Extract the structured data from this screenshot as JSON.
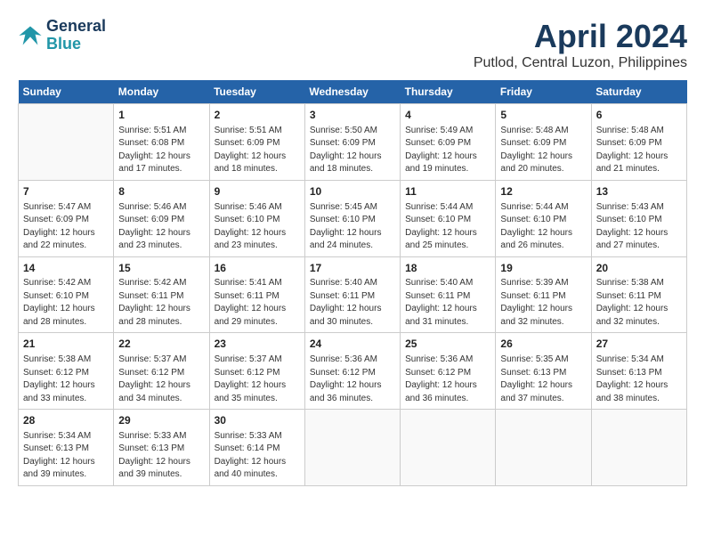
{
  "header": {
    "logo_line1": "General",
    "logo_line2": "Blue",
    "month": "April 2024",
    "location": "Putlod, Central Luzon, Philippines"
  },
  "calendar": {
    "days_of_week": [
      "Sunday",
      "Monday",
      "Tuesday",
      "Wednesday",
      "Thursday",
      "Friday",
      "Saturday"
    ],
    "weeks": [
      [
        {
          "day": "",
          "info": ""
        },
        {
          "day": "1",
          "info": "Sunrise: 5:51 AM\nSunset: 6:08 PM\nDaylight: 12 hours\nand 17 minutes."
        },
        {
          "day": "2",
          "info": "Sunrise: 5:51 AM\nSunset: 6:09 PM\nDaylight: 12 hours\nand 18 minutes."
        },
        {
          "day": "3",
          "info": "Sunrise: 5:50 AM\nSunset: 6:09 PM\nDaylight: 12 hours\nand 18 minutes."
        },
        {
          "day": "4",
          "info": "Sunrise: 5:49 AM\nSunset: 6:09 PM\nDaylight: 12 hours\nand 19 minutes."
        },
        {
          "day": "5",
          "info": "Sunrise: 5:48 AM\nSunset: 6:09 PM\nDaylight: 12 hours\nand 20 minutes."
        },
        {
          "day": "6",
          "info": "Sunrise: 5:48 AM\nSunset: 6:09 PM\nDaylight: 12 hours\nand 21 minutes."
        }
      ],
      [
        {
          "day": "7",
          "info": "Sunrise: 5:47 AM\nSunset: 6:09 PM\nDaylight: 12 hours\nand 22 minutes."
        },
        {
          "day": "8",
          "info": "Sunrise: 5:46 AM\nSunset: 6:09 PM\nDaylight: 12 hours\nand 23 minutes."
        },
        {
          "day": "9",
          "info": "Sunrise: 5:46 AM\nSunset: 6:10 PM\nDaylight: 12 hours\nand 23 minutes."
        },
        {
          "day": "10",
          "info": "Sunrise: 5:45 AM\nSunset: 6:10 PM\nDaylight: 12 hours\nand 24 minutes."
        },
        {
          "day": "11",
          "info": "Sunrise: 5:44 AM\nSunset: 6:10 PM\nDaylight: 12 hours\nand 25 minutes."
        },
        {
          "day": "12",
          "info": "Sunrise: 5:44 AM\nSunset: 6:10 PM\nDaylight: 12 hours\nand 26 minutes."
        },
        {
          "day": "13",
          "info": "Sunrise: 5:43 AM\nSunset: 6:10 PM\nDaylight: 12 hours\nand 27 minutes."
        }
      ],
      [
        {
          "day": "14",
          "info": "Sunrise: 5:42 AM\nSunset: 6:10 PM\nDaylight: 12 hours\nand 28 minutes."
        },
        {
          "day": "15",
          "info": "Sunrise: 5:42 AM\nSunset: 6:11 PM\nDaylight: 12 hours\nand 28 minutes."
        },
        {
          "day": "16",
          "info": "Sunrise: 5:41 AM\nSunset: 6:11 PM\nDaylight: 12 hours\nand 29 minutes."
        },
        {
          "day": "17",
          "info": "Sunrise: 5:40 AM\nSunset: 6:11 PM\nDaylight: 12 hours\nand 30 minutes."
        },
        {
          "day": "18",
          "info": "Sunrise: 5:40 AM\nSunset: 6:11 PM\nDaylight: 12 hours\nand 31 minutes."
        },
        {
          "day": "19",
          "info": "Sunrise: 5:39 AM\nSunset: 6:11 PM\nDaylight: 12 hours\nand 32 minutes."
        },
        {
          "day": "20",
          "info": "Sunrise: 5:38 AM\nSunset: 6:11 PM\nDaylight: 12 hours\nand 32 minutes."
        }
      ],
      [
        {
          "day": "21",
          "info": "Sunrise: 5:38 AM\nSunset: 6:12 PM\nDaylight: 12 hours\nand 33 minutes."
        },
        {
          "day": "22",
          "info": "Sunrise: 5:37 AM\nSunset: 6:12 PM\nDaylight: 12 hours\nand 34 minutes."
        },
        {
          "day": "23",
          "info": "Sunrise: 5:37 AM\nSunset: 6:12 PM\nDaylight: 12 hours\nand 35 minutes."
        },
        {
          "day": "24",
          "info": "Sunrise: 5:36 AM\nSunset: 6:12 PM\nDaylight: 12 hours\nand 36 minutes."
        },
        {
          "day": "25",
          "info": "Sunrise: 5:36 AM\nSunset: 6:12 PM\nDaylight: 12 hours\nand 36 minutes."
        },
        {
          "day": "26",
          "info": "Sunrise: 5:35 AM\nSunset: 6:13 PM\nDaylight: 12 hours\nand 37 minutes."
        },
        {
          "day": "27",
          "info": "Sunrise: 5:34 AM\nSunset: 6:13 PM\nDaylight: 12 hours\nand 38 minutes."
        }
      ],
      [
        {
          "day": "28",
          "info": "Sunrise: 5:34 AM\nSunset: 6:13 PM\nDaylight: 12 hours\nand 39 minutes."
        },
        {
          "day": "29",
          "info": "Sunrise: 5:33 AM\nSunset: 6:13 PM\nDaylight: 12 hours\nand 39 minutes."
        },
        {
          "day": "30",
          "info": "Sunrise: 5:33 AM\nSunset: 6:14 PM\nDaylight: 12 hours\nand 40 minutes."
        },
        {
          "day": "",
          "info": ""
        },
        {
          "day": "",
          "info": ""
        },
        {
          "day": "",
          "info": ""
        },
        {
          "day": "",
          "info": ""
        }
      ]
    ]
  }
}
